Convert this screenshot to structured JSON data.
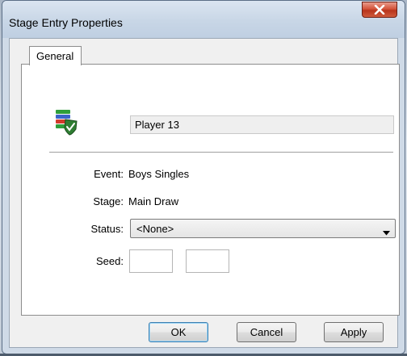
{
  "window": {
    "title": "Stage Entry Properties",
    "close_icon": "close-icon"
  },
  "tabs": [
    {
      "label": "General",
      "selected": true
    }
  ],
  "entry": {
    "icon": "stage-entry-icon",
    "name": "Player 13"
  },
  "fields": {
    "event_label": "Event:",
    "event_value": "Boys Singles",
    "stage_label": "Stage:",
    "stage_value": "Main Draw",
    "status_label": "Status:",
    "status_value": "<None>",
    "seed_label": "Seed:",
    "seed_value_1": "",
    "seed_value_2": ""
  },
  "buttons": {
    "ok": "OK",
    "cancel": "Cancel",
    "apply": "Apply"
  },
  "colors": {
    "close_button": "#c9462c",
    "default_button_border": "#3c7fb1"
  }
}
